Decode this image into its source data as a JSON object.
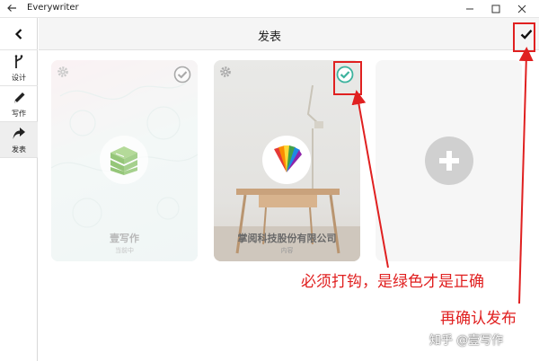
{
  "window": {
    "title": "Everywriter"
  },
  "sidebar": {
    "items": [
      {
        "label": "设计",
        "icon": "fork-icon"
      },
      {
        "label": "写作",
        "icon": "pencil-icon"
      },
      {
        "label": "发表",
        "icon": "share-arrow-icon",
        "active": true
      }
    ]
  },
  "header": {
    "title": "发表"
  },
  "cards": [
    {
      "name": "壹写作",
      "status": "当前中",
      "selected": false,
      "logo": "green-stack-logo"
    },
    {
      "name": "掌阅科技股份有限公司",
      "status": "内容",
      "selected": true,
      "logo": "colorful-book-logo"
    }
  ],
  "annotations": {
    "select_hint": "必须打钩，是绿色才是正确",
    "publish_hint": "再确认发布"
  },
  "watermark": "知乎 @壹写作",
  "colors": {
    "accent_check": "#3db39e",
    "annotation_red": "#e02020",
    "logo_green": "#8cc36a"
  }
}
